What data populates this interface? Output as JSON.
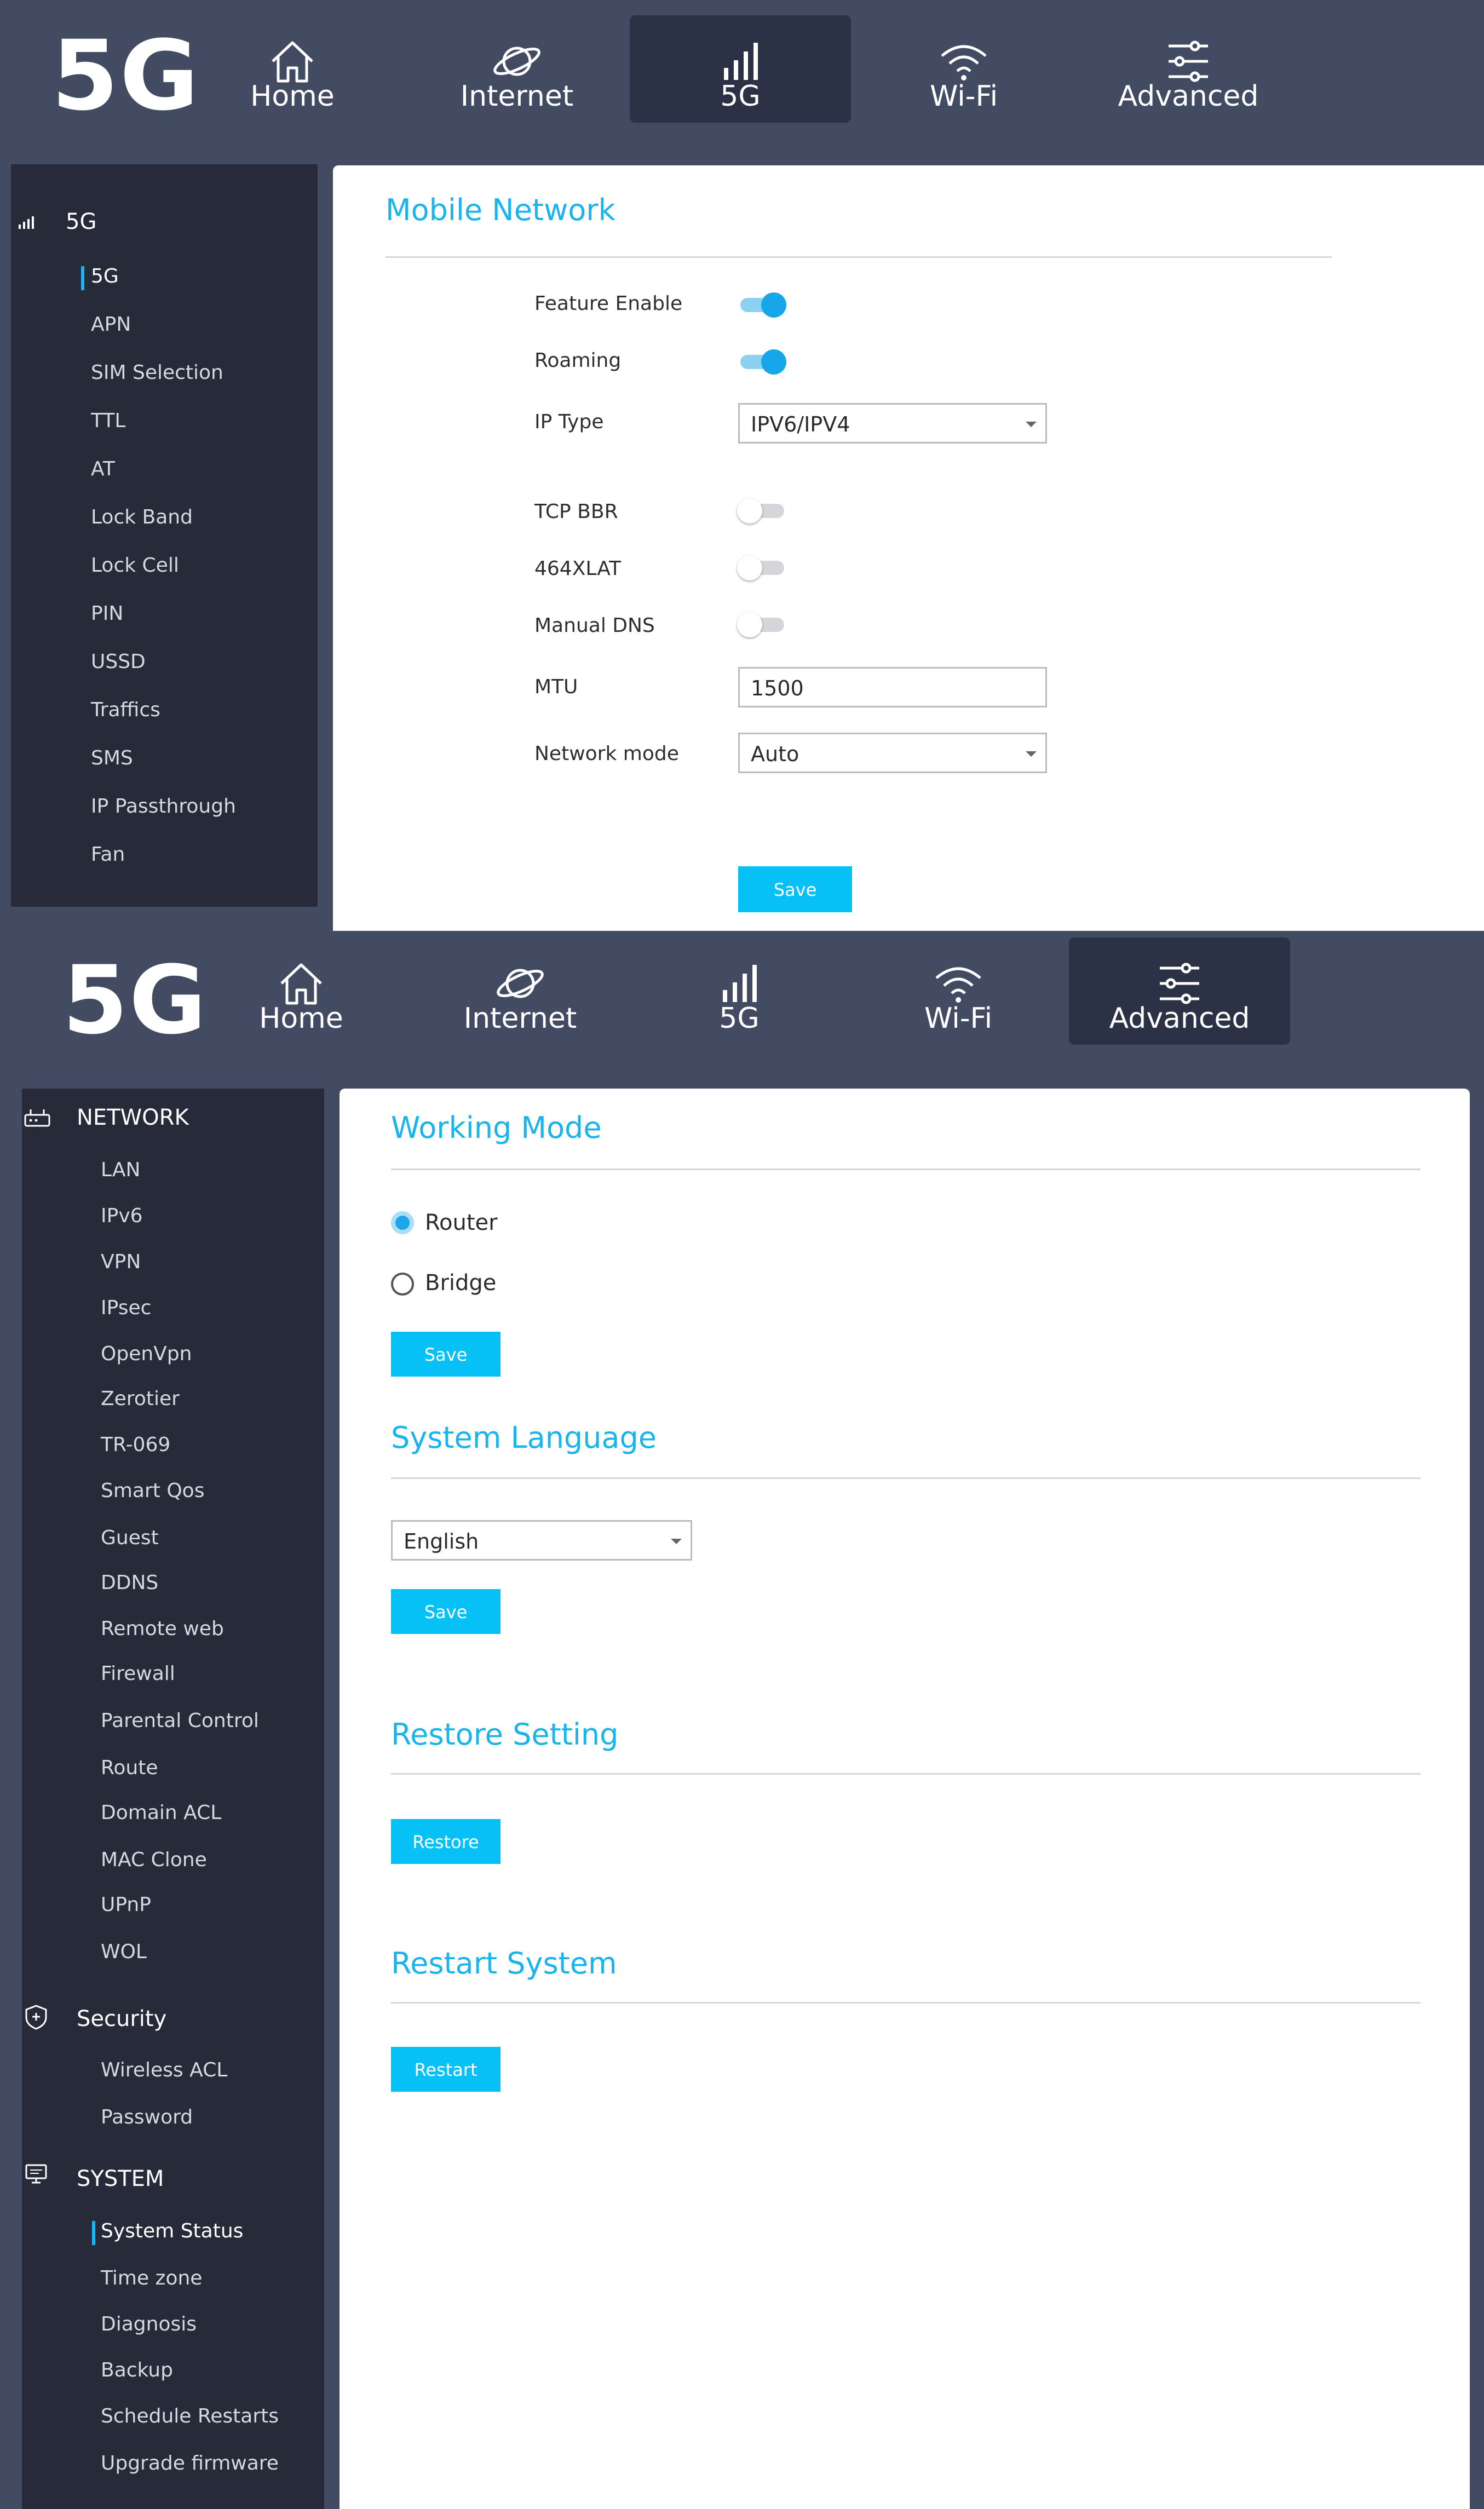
{
  "screen1": {
    "logo": "5G",
    "nav": [
      {
        "label": "Home",
        "icon": "home-icon",
        "active": false
      },
      {
        "label": "Internet",
        "icon": "planet-icon",
        "active": false
      },
      {
        "label": "5G",
        "icon": "signal-icon",
        "active": true
      },
      {
        "label": "Wi-Fi",
        "icon": "wifi-icon",
        "active": false
      },
      {
        "label": "Advanced",
        "icon": "sliders-icon",
        "active": false
      }
    ],
    "sidebar": {
      "heading": "5G",
      "heading_icon": "signal-icon",
      "items": [
        "5G",
        "APN",
        "SIM Selection",
        "TTL",
        "AT",
        "Lock Band",
        "Lock Cell",
        "PIN",
        "USSD",
        "Traffics",
        "SMS",
        "IP Passthrough",
        "Fan"
      ],
      "active_item": "5G"
    },
    "content": {
      "title": "Mobile Network",
      "fields": {
        "feature_enable": {
          "label": "Feature Enable",
          "on": true
        },
        "roaming": {
          "label": "Roaming",
          "on": true
        },
        "ip_type": {
          "label": "IP Type",
          "value": "IPV6/IPV4"
        },
        "tcp_bbr": {
          "label": "TCP BBR",
          "on": false
        },
        "xlat": {
          "label": "464XLAT",
          "on": false
        },
        "manual_dns": {
          "label": "Manual DNS",
          "on": false
        },
        "mtu": {
          "label": "MTU",
          "value": "1500"
        },
        "network_mode": {
          "label": "Network mode",
          "value": "Auto"
        }
      },
      "save_label": "Save"
    }
  },
  "screen2": {
    "logo": "5G",
    "nav": [
      {
        "label": "Home",
        "icon": "home-icon",
        "active": false
      },
      {
        "label": "Internet",
        "icon": "planet-icon",
        "active": false
      },
      {
        "label": "5G",
        "icon": "signal-icon",
        "active": false
      },
      {
        "label": "Wi-Fi",
        "icon": "wifi-icon",
        "active": false
      },
      {
        "label": "Advanced",
        "icon": "sliders-icon",
        "active": true
      }
    ],
    "sidebar": {
      "network": {
        "heading": "NETWORK",
        "icon": "router-icon",
        "items": [
          "LAN",
          "IPv6",
          "VPN",
          "IPsec",
          "OpenVpn",
          "Zerotier",
          "TR-069",
          "Smart Qos",
          "Guest",
          "DDNS",
          "Remote web",
          "Firewall",
          "Parental Control",
          "Route",
          "Domain ACL",
          "MAC Clone",
          "UPnP",
          "WOL"
        ]
      },
      "security": {
        "heading": "Security",
        "icon": "shield-icon",
        "items": [
          "Wireless ACL",
          "Password"
        ]
      },
      "system": {
        "heading": "SYSTEM",
        "icon": "monitor-icon",
        "items": [
          "System Status",
          "Time zone",
          "Diagnosis",
          "Backup",
          "Schedule Restarts",
          "Upgrade firmware"
        ],
        "active_item": "System Status"
      }
    },
    "content": {
      "working_mode": {
        "title": "Working Mode",
        "options": [
          {
            "label": "Router",
            "checked": true
          },
          {
            "label": "Bridge",
            "checked": false
          }
        ],
        "save_label": "Save"
      },
      "language": {
        "title": "System Language",
        "value": "English",
        "save_label": "Save"
      },
      "restore": {
        "title": "Restore Setting",
        "button_label": "Restore"
      },
      "restart": {
        "title": "Restart System",
        "button_label": "Restart"
      }
    }
  },
  "colors": {
    "background": "#434b63",
    "active_nav": "#2c3245",
    "sidebar": "#262a39",
    "accent": "#19b4ec",
    "button": "#07c1f6"
  }
}
